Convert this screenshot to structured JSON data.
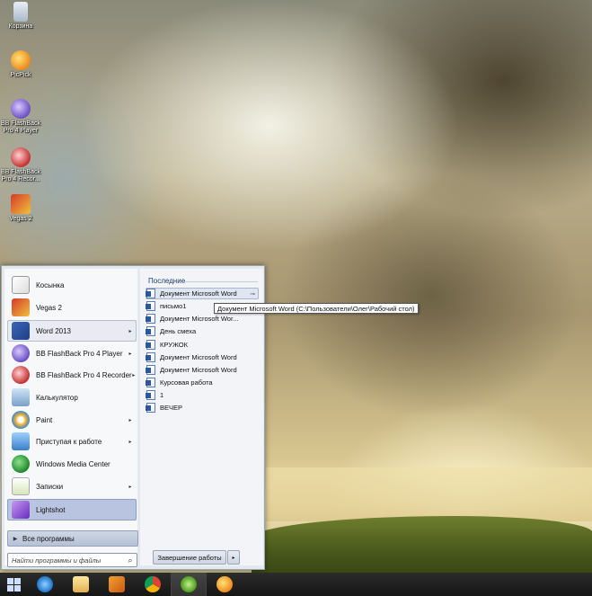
{
  "desktop": {
    "icons": [
      {
        "name": "recycle-bin",
        "label": "Корзина"
      },
      {
        "name": "picpick",
        "label": "PicPick"
      },
      {
        "name": "bb-flashback-player",
        "label": "BB FlashBack Pro 4 Player"
      },
      {
        "name": "bb-flashback-recorder",
        "label": "BB FlashBack Pro 4 Recor..."
      },
      {
        "name": "vegas-2",
        "label": "Vegas 2"
      }
    ]
  },
  "start_menu": {
    "programs": [
      {
        "label": "Косынка",
        "icon": "solitaire-icon",
        "has_arrow": false
      },
      {
        "label": "Vegas 2",
        "icon": "vegas-icon",
        "has_arrow": false
      },
      {
        "label": "Word 2013",
        "icon": "word-icon",
        "has_arrow": true,
        "state": "selected"
      },
      {
        "label": "BB FlashBack Pro 4 Player",
        "icon": "bb-player-icon",
        "has_arrow": true
      },
      {
        "label": "BB FlashBack Pro 4 Recorder",
        "icon": "bb-recorder-icon",
        "has_arrow": true
      },
      {
        "label": "Калькулятор",
        "icon": "calculator-icon",
        "has_arrow": false
      },
      {
        "label": "Paint",
        "icon": "paint-icon",
        "has_arrow": true
      },
      {
        "label": "Приступая к работе",
        "icon": "getting-started-icon",
        "has_arrow": true
      },
      {
        "label": "Windows Media Center",
        "icon": "media-center-icon",
        "has_arrow": false
      },
      {
        "label": "Записки",
        "icon": "sticky-notes-icon",
        "has_arrow": true
      },
      {
        "label": "Lightshot",
        "icon": "lightshot-icon",
        "has_arrow": false,
        "state": "highlight"
      }
    ],
    "all_programs_label": "Все программы",
    "search_placeholder": "Найти программы и файлы",
    "recent_title": "Последние",
    "recent_items": [
      {
        "label": "Документ Microsoft Word",
        "pinned": true
      },
      {
        "label": "письмо1"
      },
      {
        "label": "Документ Microsoft Wor..."
      },
      {
        "label": "День смеха"
      },
      {
        "label": "КРУЖОК"
      },
      {
        "label": "Документ Microsoft Word"
      },
      {
        "label": "Документ Microsoft Word"
      },
      {
        "label": "Курсовая работа"
      },
      {
        "label": "1"
      },
      {
        "label": "ВЕЧЕР"
      }
    ],
    "tooltip": "Документ Microsoft Word (C:\\Пользователи\\Олег\\Рабочий стол)",
    "shutdown_label": "Завершение работы"
  },
  "taskbar": {
    "items": [
      "internet-explorer-icon",
      "file-explorer-icon",
      "media-player-icon",
      "chrome-icon",
      "utorrent-icon",
      "picpick-icon"
    ],
    "active_index": 4
  }
}
